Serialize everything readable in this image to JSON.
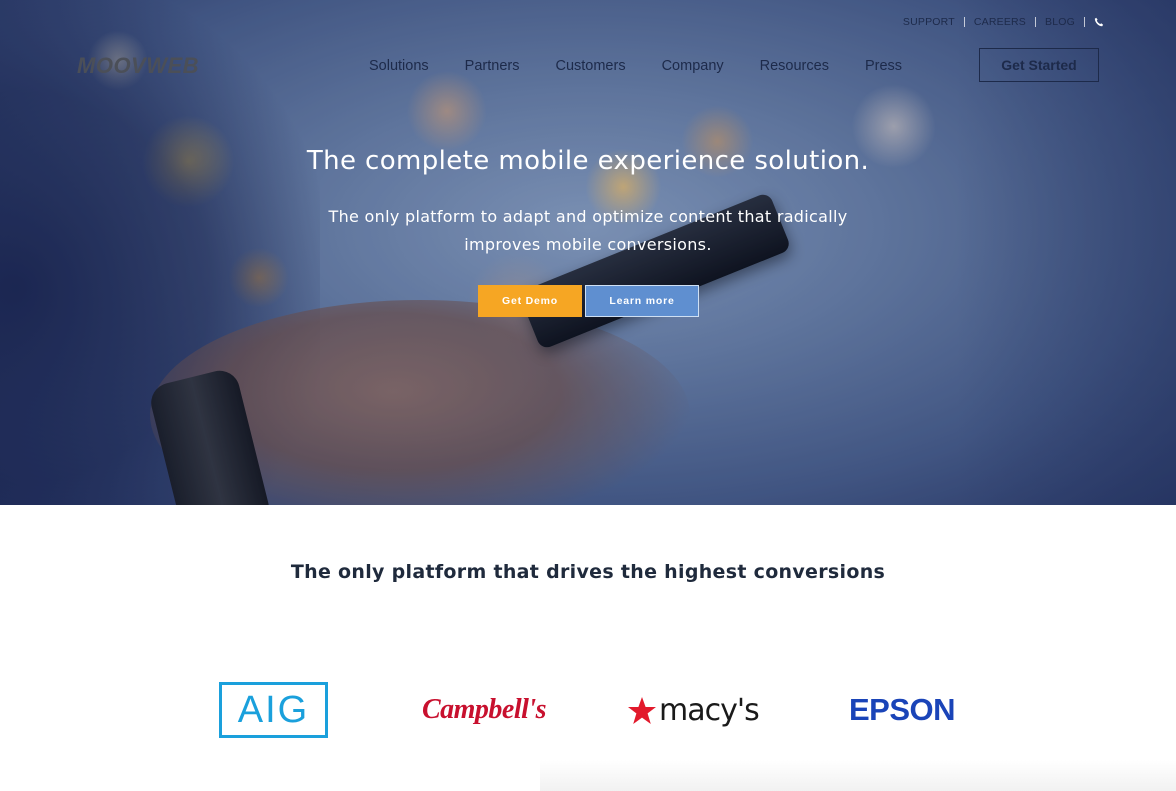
{
  "utility_nav": {
    "support": "SUPPORT",
    "careers": "CAREERS",
    "blog": "BLOG",
    "phone_icon": "phone-icon"
  },
  "brand": {
    "logo_text": "MOOVWEB"
  },
  "main_nav": {
    "items": [
      {
        "label": "Solutions"
      },
      {
        "label": "Partners"
      },
      {
        "label": "Customers"
      },
      {
        "label": "Company"
      },
      {
        "label": "Resources"
      },
      {
        "label": "Press"
      }
    ],
    "cta_label": "Get Started"
  },
  "hero": {
    "title": "The complete mobile experience solution.",
    "subtitle": "The only platform to adapt and optimize content that radically improves mobile conversions.",
    "primary_cta": "Get Demo",
    "secondary_cta": "Learn more"
  },
  "customers": {
    "heading": "The only platform that drives the highest conversions",
    "logos": [
      {
        "name": "AIG"
      },
      {
        "name": "Campbell's"
      },
      {
        "name": "macy's"
      },
      {
        "name": "EPSON"
      }
    ]
  },
  "colors": {
    "primary_cta": "#f6a623",
    "secondary_cta": "#5f8fd0",
    "nav_text": "#1d2a4a",
    "aig_blue": "#1aa0dc",
    "campbells_red": "#c8102e",
    "macys_red": "#e21a2c",
    "epson_blue": "#1a44b8"
  }
}
